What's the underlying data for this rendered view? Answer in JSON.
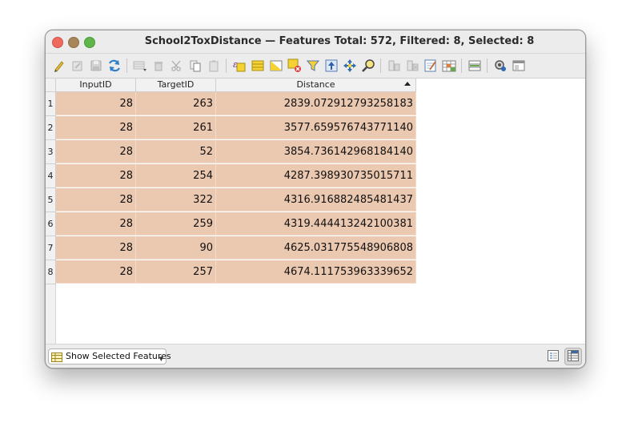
{
  "window": {
    "title": "School2ToxDistance — Features Total: 572, Filtered: 8, Selected: 8"
  },
  "toolbar": {
    "buttons": [
      {
        "icon": "pencil-icon",
        "label": "Toggle editing mode"
      },
      {
        "icon": "edit-multiple-icon",
        "label": "Toggle multi edit mode"
      },
      {
        "icon": "save-icon",
        "label": "Save edits"
      },
      {
        "icon": "reload-icon",
        "label": "Reload the table"
      },
      {
        "icon": "add-feature-icon",
        "label": "Add feature"
      },
      {
        "icon": "delete-icon",
        "label": "Delete selected features"
      },
      {
        "icon": "cut-icon",
        "label": "Cut selected rows"
      },
      {
        "icon": "copy-icon",
        "label": "Copy selected rows"
      },
      {
        "icon": "paste-icon",
        "label": "Paste features"
      },
      {
        "icon": "expression-select-icon",
        "label": "Select features using an expression"
      },
      {
        "icon": "select-all-icon",
        "label": "Select all"
      },
      {
        "icon": "invert-selection-icon",
        "label": "Invert selection"
      },
      {
        "icon": "deselect-icon",
        "label": "Deselect all"
      },
      {
        "icon": "filter-icon",
        "label": "Filter/select features using form"
      },
      {
        "icon": "move-to-top-icon",
        "label": "Move selection to top"
      },
      {
        "icon": "pan-to-selected-icon",
        "label": "Pan map to selected rows"
      },
      {
        "icon": "zoom-to-selected-icon",
        "label": "Zoom map to selected rows"
      },
      {
        "icon": "new-field-icon",
        "label": "New field"
      },
      {
        "icon": "delete-field-icon",
        "label": "Delete field"
      },
      {
        "icon": "field-calculator-icon",
        "label": "Open field calculator"
      },
      {
        "icon": "conditional-formatting-icon",
        "label": "Conditional formatting"
      },
      {
        "icon": "organize-columns-icon",
        "label": "Organize columns"
      },
      {
        "icon": "actions-icon",
        "label": "Actions"
      },
      {
        "icon": "dock-icon",
        "label": "Dock attribute table"
      }
    ]
  },
  "table": {
    "columns": [
      "InputID",
      "TargetID",
      "Distance"
    ],
    "sorted_column": "Distance",
    "sort_direction": "ascending",
    "selection_color": "#ebc8b0",
    "rows": [
      {
        "num": "1",
        "InputID": "28",
        "TargetID": "263",
        "Distance": "2839.072912793258183"
      },
      {
        "num": "2",
        "InputID": "28",
        "TargetID": "261",
        "Distance": "3577.659576743771140"
      },
      {
        "num": "3",
        "InputID": "28",
        "TargetID": "52",
        "Distance": "3854.736142968184140"
      },
      {
        "num": "4",
        "InputID": "28",
        "TargetID": "254",
        "Distance": "4287.398930735015711"
      },
      {
        "num": "5",
        "InputID": "28",
        "TargetID": "322",
        "Distance": "4316.916882485481437"
      },
      {
        "num": "6",
        "InputID": "28",
        "TargetID": "259",
        "Distance": "4319.444413242100381"
      },
      {
        "num": "7",
        "InputID": "28",
        "TargetID": "90",
        "Distance": "4625.031775548906808"
      },
      {
        "num": "8",
        "InputID": "28",
        "TargetID": "257",
        "Distance": "4674.111753963339652"
      }
    ]
  },
  "bottombar": {
    "filter_label": "Show Selected Features",
    "filter_icon": "table-icon",
    "view_buttons": [
      {
        "icon": "form-view-icon",
        "active": false
      },
      {
        "icon": "table-view-icon",
        "active": true
      }
    ]
  },
  "colors": {
    "close": "#ed6a5e",
    "minimize": "#a8865a",
    "maximize": "#5fb548"
  }
}
